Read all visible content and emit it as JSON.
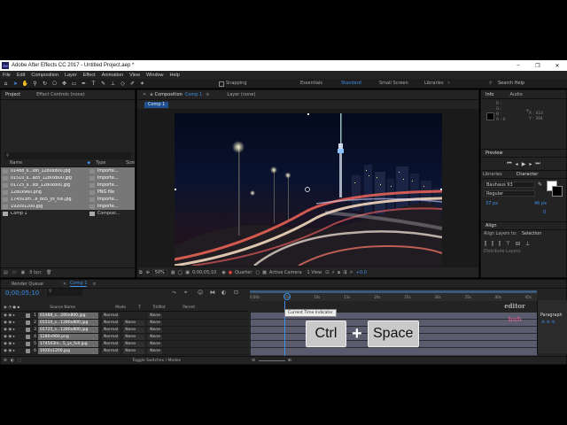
{
  "window": {
    "title": "Adobe After Effects CC 2017 - Untitled Project.aep *",
    "logo": "Ae",
    "min": "–",
    "max": "❐",
    "close": "✕"
  },
  "menu": [
    "File",
    "Edit",
    "Composition",
    "Layer",
    "Effect",
    "Animation",
    "View",
    "Window",
    "Help"
  ],
  "toolbar": {
    "snapping": "Snapping",
    "workspaces": [
      "Essentials",
      "Standard",
      "Small Screen",
      "Libraries"
    ],
    "search_placeholder": "Search Help"
  },
  "project": {
    "tab": "Project",
    "tab2": "Effect Controls (none)",
    "col_name": "Name",
    "col_type": "Type",
    "col_size": "Size",
    "items": [
      {
        "name": "01488_s...ion_1280x800.jpg",
        "type": "Importe..."
      },
      {
        "name": "01510_s...ach_1280x800.jpg",
        "type": "Importe..."
      },
      {
        "name": "01725_s...sol_1280x800.jpg",
        "type": "Importe..."
      },
      {
        "name": "1280x960.png",
        "type": "PNG file"
      },
      {
        "name": "174503m...e_805_ys_full.jpg",
        "type": "Importe..."
      },
      {
        "name": "1920x1200.jpg",
        "type": "Importe..."
      },
      {
        "name": "Comp 1",
        "type": "Composi..."
      }
    ],
    "bpc": "8 bpc"
  },
  "composition": {
    "tab": "Composition",
    "tab_name": "Comp 1",
    "layer_tab": "Layer (none)",
    "sub_tab": "Comp 1",
    "zoom": "50%",
    "timecode": "0;00;05;10",
    "resolution": "Quarter",
    "camera": "Active Camera",
    "views": "1 View",
    "exposure": "+0.0"
  },
  "info": {
    "tab": "Info",
    "tab2": "Audio",
    "r": "R :",
    "g": "G :",
    "b": "B :",
    "a": "A : 0",
    "x": "X : 414",
    "y": "Y : 394"
  },
  "preview": {
    "tab": "Preview"
  },
  "libraries": {
    "tab": "Libraries",
    "char_tab": "Character"
  },
  "character": {
    "font": "Bauhaus 93",
    "style": "Regular",
    "size": "37 px",
    "leading": "46 px",
    "tracking": "0"
  },
  "align": {
    "tab": "Align",
    "align_to_label": "Align Layers to:",
    "align_to": "Selection",
    "distribute": "Distribute Layers:"
  },
  "paragraph": {
    "tab": "Paragraph"
  },
  "timeline": {
    "render_tab": "Render Queue",
    "comp_tab": "Comp 1",
    "timecode": "0;00;05;10",
    "col_source": "Source Name",
    "col_mode": "Mode",
    "col_t": "T",
    "col_trkmat": "TrkMat",
    "col_parent": "Parent",
    "toggle": "Toggle Switches / Modes",
    "tooltip": "Current Time Indicator",
    "ruler": [
      "0:00s",
      "05s",
      "10s",
      "15s",
      "20s",
      "25s",
      "30s",
      "35s",
      "40s",
      "45s"
    ],
    "layers": [
      {
        "num": "1",
        "name": "01488_s...280x800.jpg",
        "mode": "Normal",
        "trk": "",
        "parent": "None"
      },
      {
        "num": "2",
        "name": "01510_s...1280x800.jpg",
        "mode": "Normal",
        "trk": "None",
        "parent": "None"
      },
      {
        "num": "3",
        "name": "01725_s...1280x800.jpg",
        "mode": "Normal",
        "trk": "None",
        "parent": "None"
      },
      {
        "num": "4",
        "name": "1280x960.png",
        "mode": "Normal",
        "trk": "None",
        "parent": "None"
      },
      {
        "num": "5",
        "name": "174503m...5_ys_full.jpg",
        "mode": "Normal",
        "trk": "None",
        "parent": "None"
      },
      {
        "num": "6",
        "name": "1920x1200.jpg",
        "mode": "Normal",
        "trk": "None",
        "parent": "None"
      }
    ]
  },
  "shortcut": {
    "key1": "Ctrl",
    "plus": "+",
    "key2": "Space"
  },
  "watermark": {
    "line1": "editor",
    "line2": "hub"
  }
}
